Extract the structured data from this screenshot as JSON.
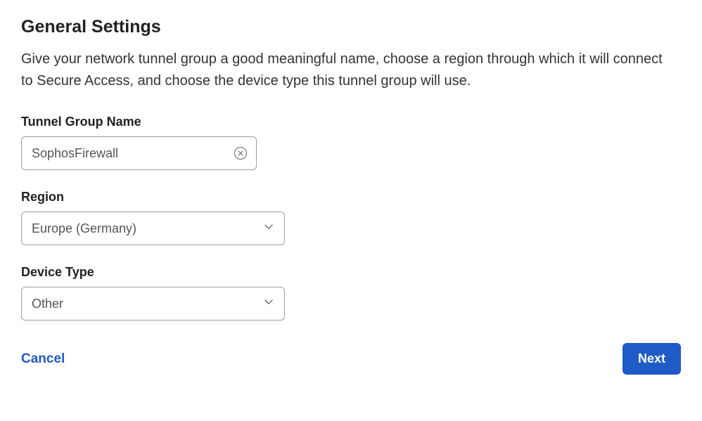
{
  "title": "General Settings",
  "description": "Give your network tunnel group a good meaningful name, choose a region through which it will connect to Secure Access, and choose the device type this tunnel group will use.",
  "fields": {
    "tunnelGroupName": {
      "label": "Tunnel Group Name",
      "value": "SophosFirewall"
    },
    "region": {
      "label": "Region",
      "value": "Europe (Germany)"
    },
    "deviceType": {
      "label": "Device Type",
      "value": "Other"
    }
  },
  "buttons": {
    "cancel": "Cancel",
    "next": "Next"
  }
}
